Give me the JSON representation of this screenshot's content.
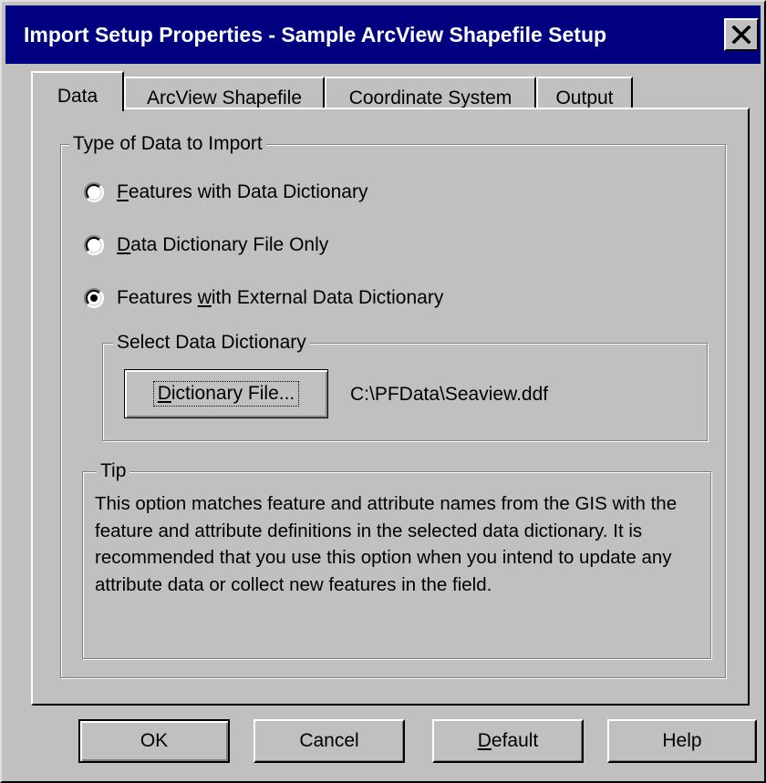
{
  "window": {
    "title": "Import Setup Properties - Sample ArcView Shapefile Setup",
    "close_icon": "close-icon"
  },
  "tabs": [
    {
      "label": "Data",
      "active": true
    },
    {
      "label": "ArcView Shapefile",
      "active": false
    },
    {
      "label": "Coordinate System",
      "active": false
    },
    {
      "label": "Output",
      "active": false
    }
  ],
  "data_type_group": {
    "legend": "Type of Data to Import",
    "options": [
      {
        "mnemonic": "F",
        "rest": "eatures with Data Dictionary",
        "selected": false
      },
      {
        "mnemonic": "D",
        "rest": "ata Dictionary File Only",
        "selected": false
      },
      {
        "prefix": "Features ",
        "mnemonic": "w",
        "rest": "ith External Data Dictionary",
        "selected": true
      }
    ]
  },
  "dictionary_group": {
    "legend": "Select Data Dictionary",
    "button_mnemonic": "D",
    "button_rest": "ictionary File...",
    "path": "C:\\PFData\\Seaview.ddf"
  },
  "tip_group": {
    "legend": "Tip",
    "text": "This option matches feature and attribute names from the GIS with the feature and attribute definitions in the selected data dictionary.  It is recommended that you use this option when you intend to update any attribute data or collect new features in the field."
  },
  "buttons": {
    "ok": "OK",
    "cancel": "Cancel",
    "default_mnemonic": "D",
    "default_rest": "efault",
    "help": "Help"
  },
  "colors": {
    "titlebar": "#000080",
    "face": "#c0c0c0"
  }
}
